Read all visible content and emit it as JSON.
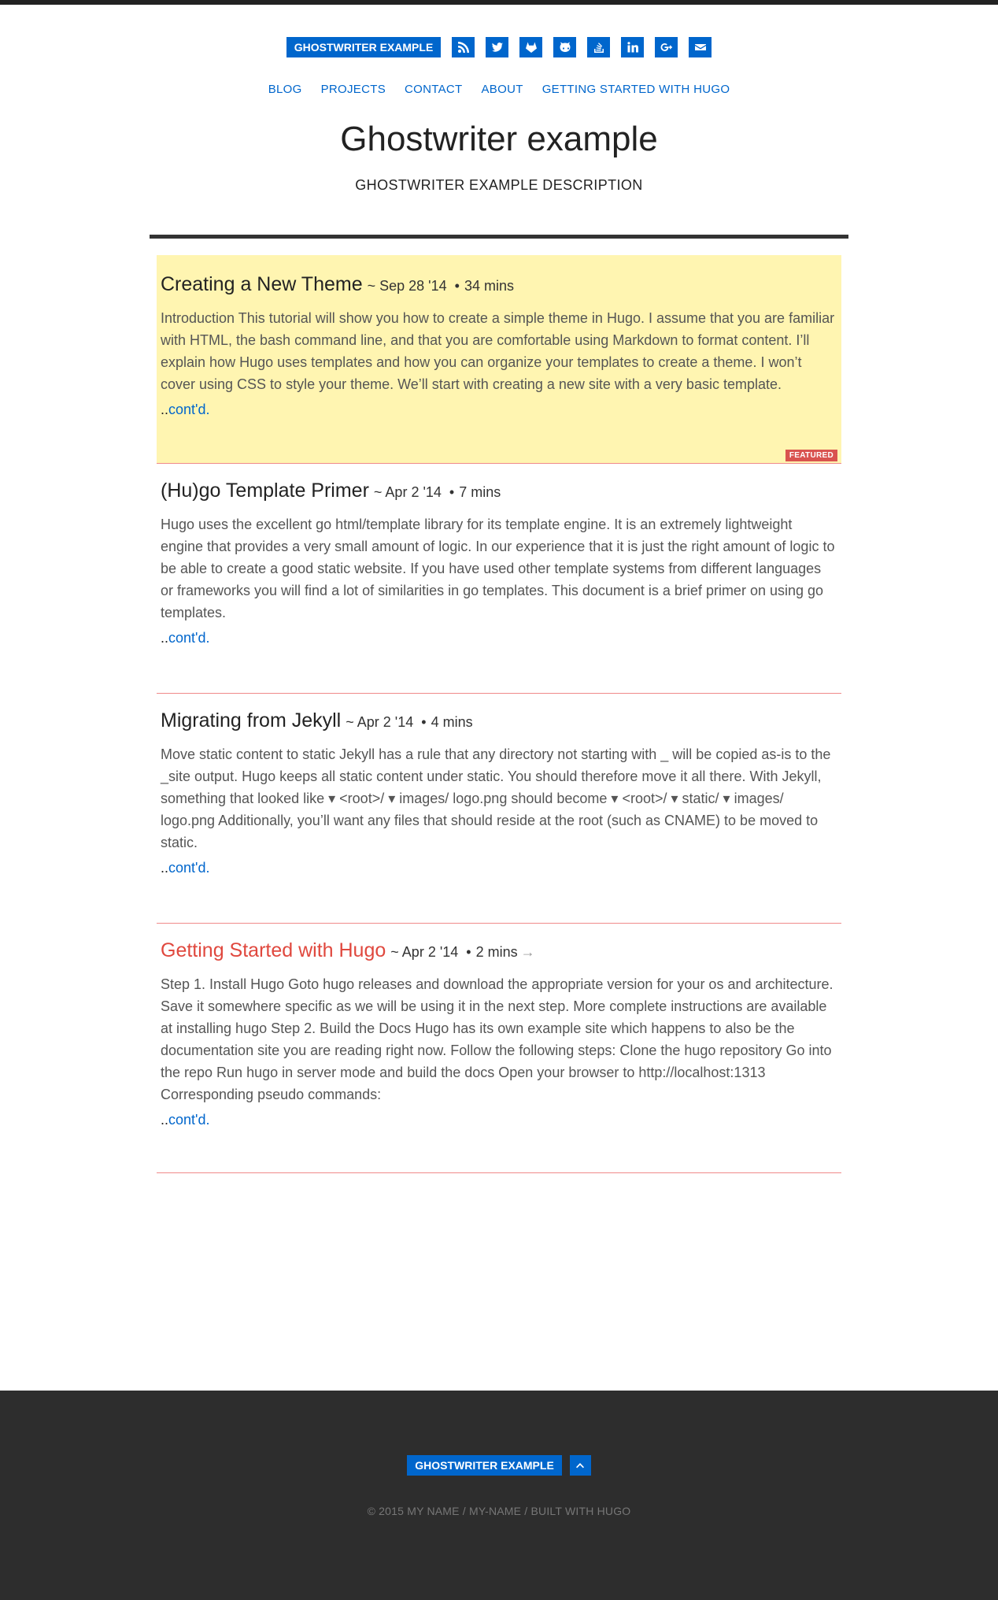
{
  "header": {
    "brand": "GHOSTWRITER EXAMPLE",
    "social": [
      "rss-icon",
      "twitter-icon",
      "gitlab-icon",
      "github-icon",
      "stackoverflow-icon",
      "linkedin-icon",
      "google-plus-icon",
      "email-icon"
    ],
    "nav": [
      "BLOG",
      "PROJECTS",
      "CONTACT",
      "ABOUT",
      "GETTING STARTED WITH HUGO"
    ],
    "title": "Ghostwriter example",
    "description": "GHOSTWRITER EXAMPLE DESCRIPTION"
  },
  "posts": [
    {
      "title": "Creating a New Theme",
      "date": "~ Sep 28 '14",
      "read": "34 mins",
      "body": "Introduction This tutorial will show you how to create a simple theme in Hugo. I assume that you are familiar with HTML, the bash command line, and that you are comfortable using Markdown to format content. I’ll explain how Hugo uses templates and how you can organize your templates to create a theme. I won’t cover using CSS to style your theme. We’ll start with creating a new site with a very basic template.",
      "more_prefix": "..",
      "more": "cont'd.",
      "badge": "FEATURED"
    },
    {
      "title": "(Hu)go Template Primer",
      "date": "~ Apr 2 '14",
      "read": "7 mins",
      "body": "Hugo uses the excellent go html/template library for its template engine. It is an extremely lightweight engine that provides a very small amount of logic. In our experience that it is just the right amount of logic to be able to create a good static website. If you have used other template systems from different languages or frameworks you will find a lot of similarities in go templates. This document is a brief primer on using go templates.",
      "more_prefix": "..",
      "more": "cont'd."
    },
    {
      "title": "Migrating from Jekyll",
      "date": "~ Apr 2 '14",
      "read": "4 mins",
      "body": "Move static content to static Jekyll has a rule that any directory not starting with _ will be copied as-is to the _site output. Hugo keeps all static content under static. You should therefore move it all there. With Jekyll, something that looked like ▾ <root>/ ▾ images/ logo.png should become ▾ <root>/ ▾ static/ ▾ images/ logo.png Additionally, you’ll want any files that should reside at the root (such as CNAME) to be moved to static.",
      "more_prefix": "..",
      "more": "cont'd."
    },
    {
      "title": "Getting Started with Hugo",
      "date": "~ Apr 2 '14",
      "read": "2 mins",
      "arrow": "→",
      "body": "Step 1. Install Hugo Goto hugo releases and download the appropriate version for your os and architecture. Save it somewhere specific as we will be using it in the next step. More complete instructions are available at installing hugo Step 2. Build the Docs Hugo has its own example site which happens to also be the documentation site you are reading right now. Follow the following steps: Clone the hugo repository Go into the repo Run hugo in server mode and build the docs Open your browser to http://localhost:1313 Corresponding pseudo commands:",
      "more_prefix": "..",
      "more": "cont'd."
    }
  ],
  "footer": {
    "brand": "GHOSTWRITER EXAMPLE",
    "copyright": "© 2015 MY NAME / MY-NAME / BUILT WITH HUGO"
  },
  "colors": {
    "accent": "#0066cc",
    "featured_bg": "#fff5b1",
    "badge": "#d9534f",
    "external_title": "#e0483e",
    "footer_bg": "#2d2d2d"
  }
}
